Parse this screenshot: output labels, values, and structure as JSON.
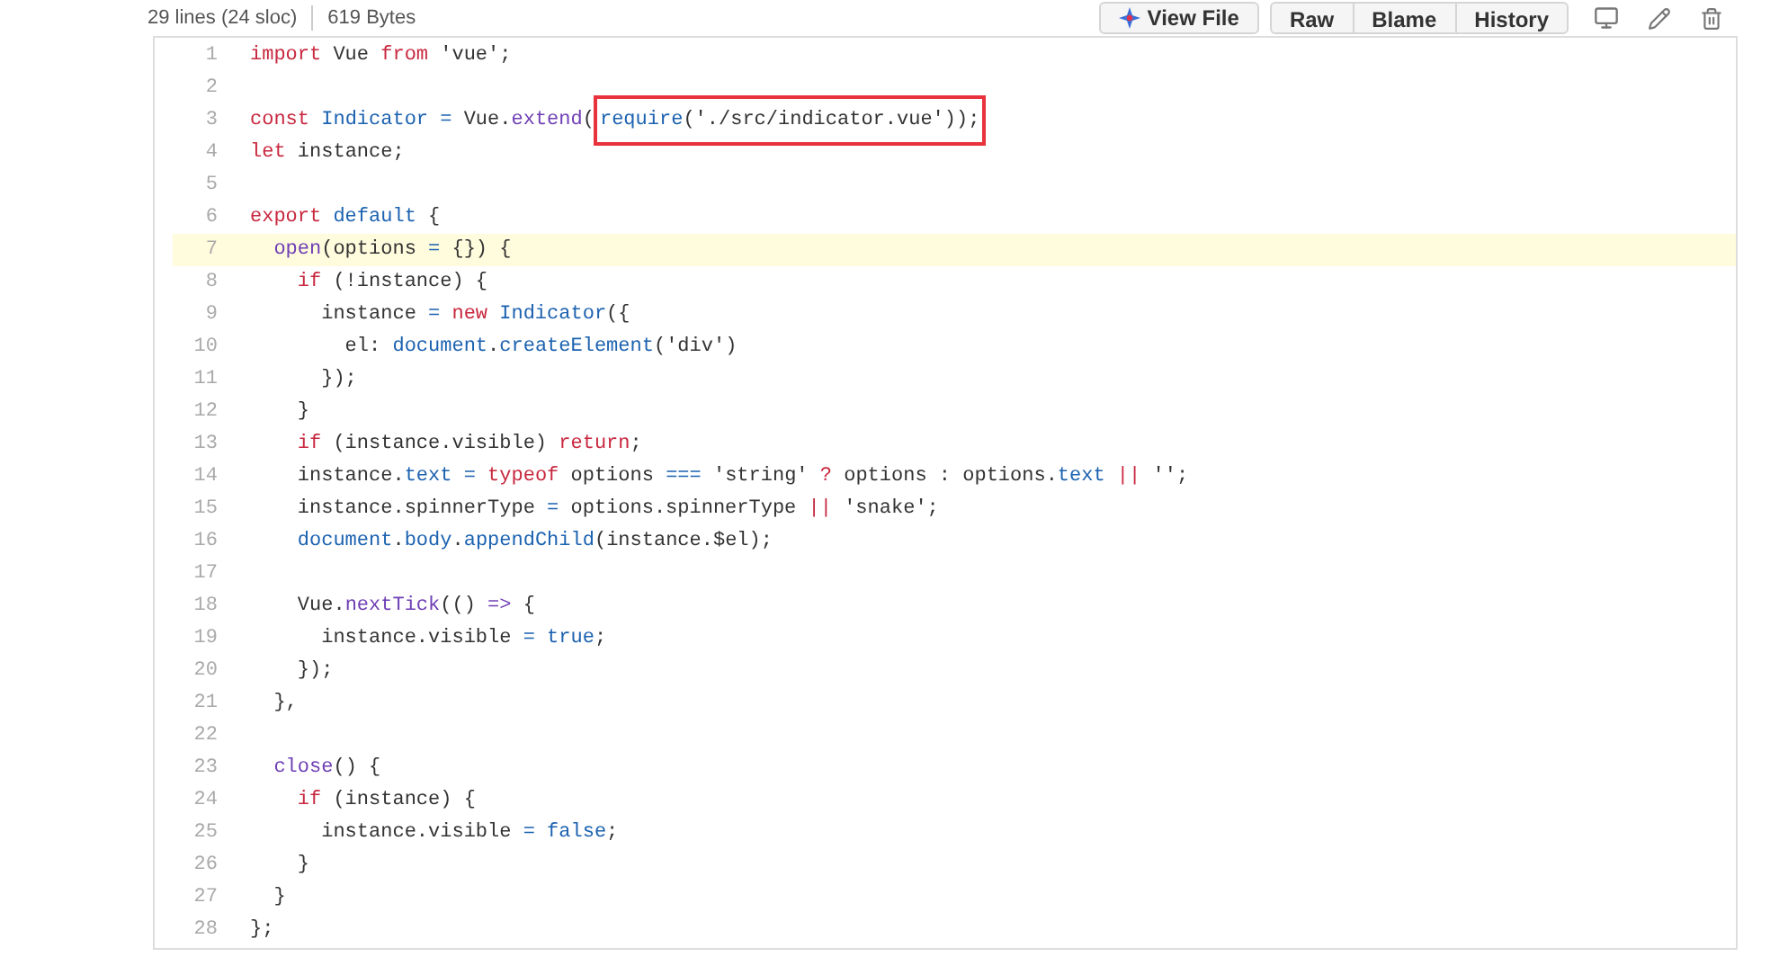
{
  "file_info": {
    "lines": "29 lines (24 sloc)",
    "size": "619 Bytes"
  },
  "actions": {
    "view_file": "View File",
    "buttons": [
      "Raw",
      "Blame",
      "History"
    ]
  },
  "code": {
    "lines": [
      {
        "number": "1",
        "selected": false,
        "tokens": [
          {
            "kind": "keyword",
            "text": "import"
          },
          {
            "kind": "plain",
            "text": " Vue "
          },
          {
            "kind": "keyword",
            "text": "from"
          },
          {
            "kind": "plain",
            "text": " 'vue';"
          }
        ]
      },
      {
        "number": "2",
        "selected": false
      },
      {
        "number": "3",
        "selected": false,
        "tokens": [
          {
            "kind": "keyword",
            "text": "const"
          },
          {
            "kind": "entity",
            "text": " Indicator"
          },
          {
            "kind": "entity",
            "text": " ="
          },
          {
            "kind": "plain",
            "text": " Vue."
          },
          {
            "kind": "function",
            "text": "extend"
          },
          {
            "kind": "plain",
            "text": "("
          }
        ],
        "annotated_tokens": [
          {
            "kind": "entity",
            "text": "require"
          },
          {
            "kind": "plain",
            "text": "('./src/indicator.vue'));"
          }
        ]
      },
      {
        "number": "4",
        "selected": false,
        "tokens": [
          {
            "kind": "keyword",
            "text": "let"
          },
          {
            "kind": "plain",
            "text": " instance;"
          }
        ]
      },
      {
        "number": "5",
        "selected": false
      },
      {
        "number": "6",
        "selected": false,
        "tokens": [
          {
            "kind": "keyword",
            "text": "export"
          },
          {
            "kind": "entity",
            "text": " default"
          },
          {
            "kind": "plain",
            "text": " {"
          }
        ]
      },
      {
        "number": "7",
        "selected": true,
        "tokens": [
          {
            "kind": "function",
            "text": "  open"
          },
          {
            "kind": "plain",
            "text": "(options"
          },
          {
            "kind": "entity",
            "text": " ="
          },
          {
            "kind": "plain",
            "text": " {}) {"
          }
        ]
      },
      {
        "number": "8",
        "selected": false,
        "tokens": [
          {
            "kind": "keyword",
            "text": "    if"
          },
          {
            "kind": "plain",
            "text": " (!instance) {"
          }
        ]
      },
      {
        "number": "9",
        "selected": false,
        "tokens": [
          {
            "kind": "plain",
            "text": "      instance"
          },
          {
            "kind": "entity",
            "text": " ="
          },
          {
            "kind": "keyword",
            "text": " new"
          },
          {
            "kind": "entity",
            "text": " Indicator"
          },
          {
            "kind": "plain",
            "text": "({"
          }
        ]
      },
      {
        "number": "10",
        "selected": false,
        "tokens": [
          {
            "kind": "plain",
            "text": "        el: "
          },
          {
            "kind": "entity",
            "text": "document"
          },
          {
            "kind": "plain",
            "text": "."
          },
          {
            "kind": "entity",
            "text": "createElement"
          },
          {
            "kind": "plain",
            "text": "('div')"
          }
        ]
      },
      {
        "number": "11",
        "selected": false,
        "tokens": [
          {
            "kind": "plain",
            "text": "      });"
          }
        ]
      },
      {
        "number": "12",
        "selected": false,
        "tokens": [
          {
            "kind": "plain",
            "text": "    }"
          }
        ]
      },
      {
        "number": "13",
        "selected": false,
        "tokens": [
          {
            "kind": "keyword",
            "text": "    if"
          },
          {
            "kind": "plain",
            "text": " (instance.visible) "
          },
          {
            "kind": "keyword",
            "text": "return"
          },
          {
            "kind": "plain",
            "text": ";"
          }
        ]
      },
      {
        "number": "14",
        "selected": false,
        "tokens": [
          {
            "kind": "plain",
            "text": "    instance."
          },
          {
            "kind": "entity",
            "text": "text"
          },
          {
            "kind": "entity",
            "text": " ="
          },
          {
            "kind": "keyword",
            "text": " typeof"
          },
          {
            "kind": "plain",
            "text": " options"
          },
          {
            "kind": "entity",
            "text": " ==="
          },
          {
            "kind": "plain",
            "text": " 'string'"
          },
          {
            "kind": "keyword",
            "text": " ?"
          },
          {
            "kind": "plain",
            "text": " options : options."
          },
          {
            "kind": "entity",
            "text": "text"
          },
          {
            "kind": "keyword",
            "text": " ||"
          },
          {
            "kind": "plain",
            "text": " '';"
          }
        ]
      },
      {
        "number": "15",
        "selected": false,
        "tokens": [
          {
            "kind": "plain",
            "text": "    instance.spinnerType"
          },
          {
            "kind": "entity",
            "text": " ="
          },
          {
            "kind": "plain",
            "text": " options.spinnerType"
          },
          {
            "kind": "keyword",
            "text": " ||"
          },
          {
            "kind": "plain",
            "text": " 'snake';"
          }
        ]
      },
      {
        "number": "16",
        "selected": false,
        "tokens": [
          {
            "kind": "entity",
            "text": "    document"
          },
          {
            "kind": "plain",
            "text": "."
          },
          {
            "kind": "entity",
            "text": "body"
          },
          {
            "kind": "plain",
            "text": "."
          },
          {
            "kind": "entity",
            "text": "appendChild"
          },
          {
            "kind": "plain",
            "text": "(instance.$el);"
          }
        ]
      },
      {
        "number": "17",
        "selected": false
      },
      {
        "number": "18",
        "selected": false,
        "tokens": [
          {
            "kind": "plain",
            "text": "    Vue."
          },
          {
            "kind": "function",
            "text": "nextTick"
          },
          {
            "kind": "plain",
            "text": "(()"
          },
          {
            "kind": "function",
            "text": " =>"
          },
          {
            "kind": "plain",
            "text": " {"
          }
        ]
      },
      {
        "number": "19",
        "selected": false,
        "tokens": [
          {
            "kind": "plain",
            "text": "      instance.visible"
          },
          {
            "kind": "entity",
            "text": " ="
          },
          {
            "kind": "entity",
            "text": " true"
          },
          {
            "kind": "plain",
            "text": ";"
          }
        ]
      },
      {
        "number": "20",
        "selected": false,
        "tokens": [
          {
            "kind": "plain",
            "text": "    });"
          }
        ]
      },
      {
        "number": "21",
        "selected": false,
        "tokens": [
          {
            "kind": "plain",
            "text": "  },"
          }
        ]
      },
      {
        "number": "22",
        "selected": false
      },
      {
        "number": "23",
        "selected": false,
        "tokens": [
          {
            "kind": "function",
            "text": "  close"
          },
          {
            "kind": "plain",
            "text": "() {"
          }
        ]
      },
      {
        "number": "24",
        "selected": false,
        "tokens": [
          {
            "kind": "keyword",
            "text": "    if"
          },
          {
            "kind": "plain",
            "text": " (instance) {"
          }
        ]
      },
      {
        "number": "25",
        "selected": false,
        "tokens": [
          {
            "kind": "plain",
            "text": "      instance.visible"
          },
          {
            "kind": "entity",
            "text": " ="
          },
          {
            "kind": "entity",
            "text": " false"
          },
          {
            "kind": "plain",
            "text": ";"
          }
        ]
      },
      {
        "number": "26",
        "selected": false,
        "tokens": [
          {
            "kind": "plain",
            "text": "    }"
          }
        ]
      },
      {
        "number": "27",
        "selected": false,
        "tokens": [
          {
            "kind": "plain",
            "text": "  }"
          }
        ]
      },
      {
        "number": "28",
        "selected": false,
        "tokens": [
          {
            "kind": "plain",
            "text": "};"
          }
        ]
      }
    ]
  }
}
